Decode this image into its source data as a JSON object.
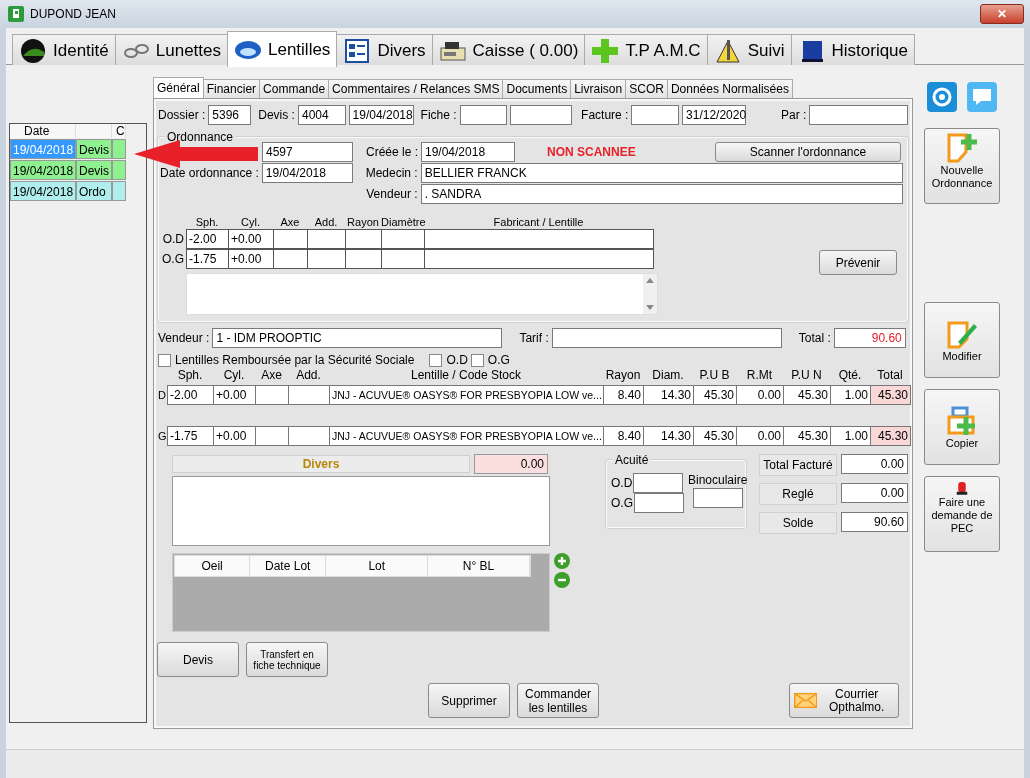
{
  "window": {
    "title": "DUPOND JEAN",
    "close": "✕"
  },
  "main_tabs": [
    {
      "label": "Identité",
      "selected": false
    },
    {
      "label": "Lunettes",
      "selected": false
    },
    {
      "label": "Lentilles",
      "selected": true
    },
    {
      "label": "Divers",
      "selected": false
    },
    {
      "label": "Caisse ( 0.00)",
      "selected": false
    },
    {
      "label": "T.P A.M.C",
      "selected": false
    },
    {
      "label": "Suivi",
      "selected": false
    },
    {
      "label": "Historique",
      "selected": false
    }
  ],
  "history": {
    "columns": [
      "Date",
      "",
      "C"
    ],
    "rows": [
      {
        "date": "19/04/2018",
        "type": "Devis",
        "selected": true,
        "color": "#8ef08e"
      },
      {
        "date": "19/04/2018",
        "type": "Devis",
        "selected": false,
        "color": "#8ef08e"
      },
      {
        "date": "19/04/2018",
        "type": "Ordo",
        "selected": false,
        "color": "#b0eeee"
      }
    ]
  },
  "sub_tabs": [
    {
      "label": "Général",
      "selected": true
    },
    {
      "label": "Financier",
      "selected": false
    },
    {
      "label": "Commande",
      "selected": false
    },
    {
      "label": "Commentaires / Relances SMS",
      "selected": false
    },
    {
      "label": "Documents",
      "selected": false
    },
    {
      "label": "Livraison",
      "selected": false
    },
    {
      "label": "SCOR",
      "selected": false
    },
    {
      "label": "Données Normalisées",
      "selected": false
    }
  ],
  "header": {
    "dossier_label": "Dossier :",
    "dossier": "5396",
    "devis_label": "Devis :",
    "devis": "4004",
    "devis_date": "19/04/2018",
    "fiche_label": "Fiche :",
    "facture_label": "Facture :",
    "facture_date": "31/12/2020",
    "par_label": "Par :"
  },
  "ordonnance": {
    "title": "Ordonnance",
    "number": "4597",
    "date_label": "Date ordonnance :",
    "date": "19/04/2018",
    "created_label": "Créée le :",
    "created": "19/04/2018",
    "status": "NON SCANNEE",
    "scan_button": "Scanner l'ordonnance",
    "medecin_label": "Medecin :",
    "medecin": "BELLIER FRANCK",
    "vendeur_label": "Vendeur :",
    "vendeur": ". SANDRA",
    "columns": [
      "Sph.",
      "Cyl.",
      "Axe",
      "Add.",
      "Rayon",
      "Diamètre",
      "Fabricant / Lentille"
    ],
    "rows": [
      {
        "eye": "O.D",
        "sph": "-2.00",
        "cyl": "+0.00"
      },
      {
        "eye": "O.G",
        "sph": "-1.75",
        "cyl": "+0.00"
      }
    ],
    "prevenir": "Prévenir"
  },
  "vendeur": {
    "label": "Vendeur :",
    "value": "1 - IDM PROOPTIC",
    "tarif_label": "Tarif :",
    "total_label": "Total :",
    "total": "90.60"
  },
  "checks": [
    {
      "label": "Lentilles Remboursée par la Sécurité Sociale",
      "checked": false
    },
    {
      "label": "O.D",
      "checked": false
    },
    {
      "label": "O.G",
      "checked": false
    }
  ],
  "lenses": {
    "columns": [
      "Sph.",
      "Cyl.",
      "Axe",
      "Add.",
      "Lentille / Code Stock",
      "Rayon",
      "Diam.",
      "P.U B",
      "R.Mt",
      "P.U N",
      "Qté.",
      "Total"
    ],
    "rows": [
      {
        "eye": "D",
        "sph": "-2.00",
        "cyl": "+0.00",
        "lens": "JNJ - ACUVUE® OASYS® FOR PRESBYOPIA LOW ve...",
        "rayon": "8.40",
        "diam": "14.30",
        "pub": "45.30",
        "rmt": "0.00",
        "pun": "45.30",
        "qte": "1.00",
        "total": "45.30"
      },
      {
        "eye": "G",
        "sph": "-1.75",
        "cyl": "+0.00",
        "lens": "JNJ - ACUVUE® OASYS® FOR PRESBYOPIA LOW ve...",
        "rayon": "8.40",
        "diam": "14.30",
        "pub": "45.30",
        "rmt": "0.00",
        "pun": "45.30",
        "qte": "1.00",
        "total": "45.30"
      }
    ]
  },
  "divers": {
    "label": "Divers",
    "amount": "0.00"
  },
  "lots": {
    "columns": [
      "Oeil",
      "Date Lot",
      "Lot",
      "N° BL"
    ]
  },
  "acuite": {
    "title": "Acuité",
    "od": "O.D",
    "og": "O.G",
    "binoculaire": "Binoculaire"
  },
  "totals": [
    {
      "label": "Total Facturé",
      "value": "0.00"
    },
    {
      "label": "Reglé",
      "value": "0.00"
    },
    {
      "label": "Solde",
      "value": "90.60"
    }
  ],
  "buttons": {
    "devis": "Devis",
    "transfert": "Transfert en fiche technique",
    "supprimer": "Supprimer",
    "commander": "Commander les lentilles",
    "courrier": "Courrier Opthalmo."
  },
  "side_buttons": [
    {
      "label": "Nouvelle Ordonnance",
      "kind": "new"
    },
    {
      "label": "Modifier",
      "kind": "edit"
    },
    {
      "label": "Copier",
      "kind": "copy"
    },
    {
      "label": "Faire une demande de PEC",
      "kind": "alarm"
    }
  ]
}
